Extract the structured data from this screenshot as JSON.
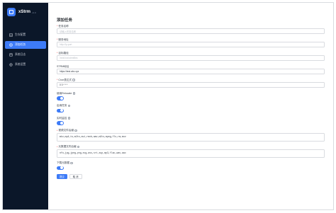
{
  "app": {
    "name": "xStrm",
    "version": "v1.0"
  },
  "sidebar": {
    "items": [
      {
        "label": "生存配置",
        "icon": "settings-icon",
        "active": false
      },
      {
        "label": "添加任务",
        "icon": "add-task-icon",
        "active": true
      },
      {
        "label": "系统日志",
        "icon": "log-icon",
        "active": false
      },
      {
        "label": "系统设置",
        "icon": "gear-icon",
        "active": false
      }
    ]
  },
  "page": {
    "title": "添加任务"
  },
  "form": {
    "task_name": {
      "label": "任务名称",
      "placeholder": "请输入任务名称"
    },
    "server_url": {
      "label": "服务地址",
      "placeholder": "http://ip:port"
    },
    "local_path": {
      "label": "目标路径",
      "placeholder": "/mnt/xxx/strmfiles"
    },
    "strm_url": {
      "label": "STRM地址",
      "value": "https://test.abc.xyz"
    },
    "cron": {
      "label": "Cron表达式",
      "value": "0 0 * * *"
    },
    "use_relative": {
      "label": "使用Relocate",
      "enabled": true
    },
    "enable_task": {
      "label": "启用任务",
      "enabled": true
    },
    "realtime_monitor": {
      "label": "实时监控",
      "enabled": true
    },
    "video_ext": {
      "label": "视频文件后缀",
      "value": "mkv,mp4,ts,m2ts,avi,rmvb,wmv,m2ts,mpeg,flv,rm,mov"
    },
    "meta_ext": {
      "label": "元数据文件后缀",
      "value": "nfo,jpg,jpeg,png,svg,ass,srt,sup,mp3,flac,wav,aac"
    },
    "download_meta": {
      "label": "下载元数据",
      "enabled": true
    },
    "submit_label": "提交",
    "cancel_label": "取 消"
  },
  "colors": {
    "accent": "#3d7bf7",
    "sidebar_bg": "#0b1729",
    "required": "#f53f3f"
  }
}
